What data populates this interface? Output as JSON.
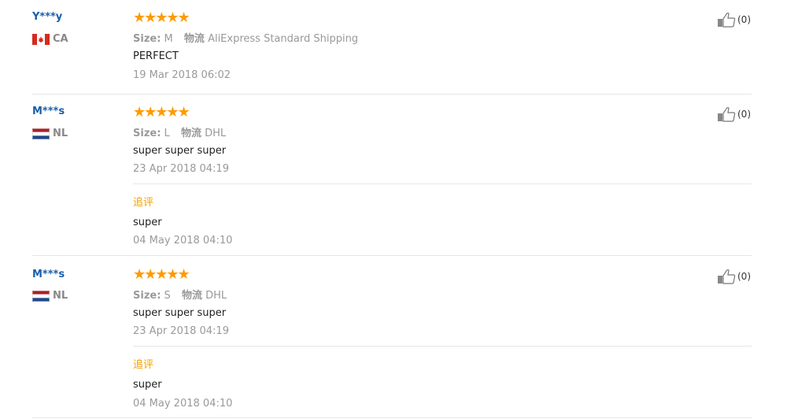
{
  "reviews": [
    {
      "user": "Y***y",
      "country": "CA",
      "rating": 5,
      "stars": "★★★★★",
      "size_label": "Size:",
      "size": "M",
      "shipping_label": "物流",
      "shipping": "AliExpress Standard Shipping",
      "text": "PERFECT",
      "date": "19 Mar 2018 06:02",
      "helpful": "(0)"
    },
    {
      "user": "M***s",
      "country": "NL",
      "rating": 5,
      "stars": "★★★★★",
      "size_label": "Size:",
      "size": "L",
      "shipping_label": "物流",
      "shipping": "DHL",
      "text": "super super super",
      "date": "23 Apr 2018 04:19",
      "helpful": "(0)",
      "followup": {
        "label": "追评",
        "text": "super",
        "date": "04 May 2018 04:10"
      }
    },
    {
      "user": "M***s",
      "country": "NL",
      "rating": 5,
      "stars": "★★★★★",
      "size_label": "Size:",
      "size": "S",
      "shipping_label": "物流",
      "shipping": "DHL",
      "text": "super super super",
      "date": "23 Apr 2018 04:19",
      "helpful": "(0)",
      "followup": {
        "label": "追评",
        "text": "super",
        "date": "04 May 2018 04:10"
      }
    }
  ],
  "colors": {
    "username": "#1a5ea8",
    "star": "#ff9a00",
    "followup": "#f5a000",
    "muted": "#999999",
    "divider": "#e6e6e6"
  }
}
